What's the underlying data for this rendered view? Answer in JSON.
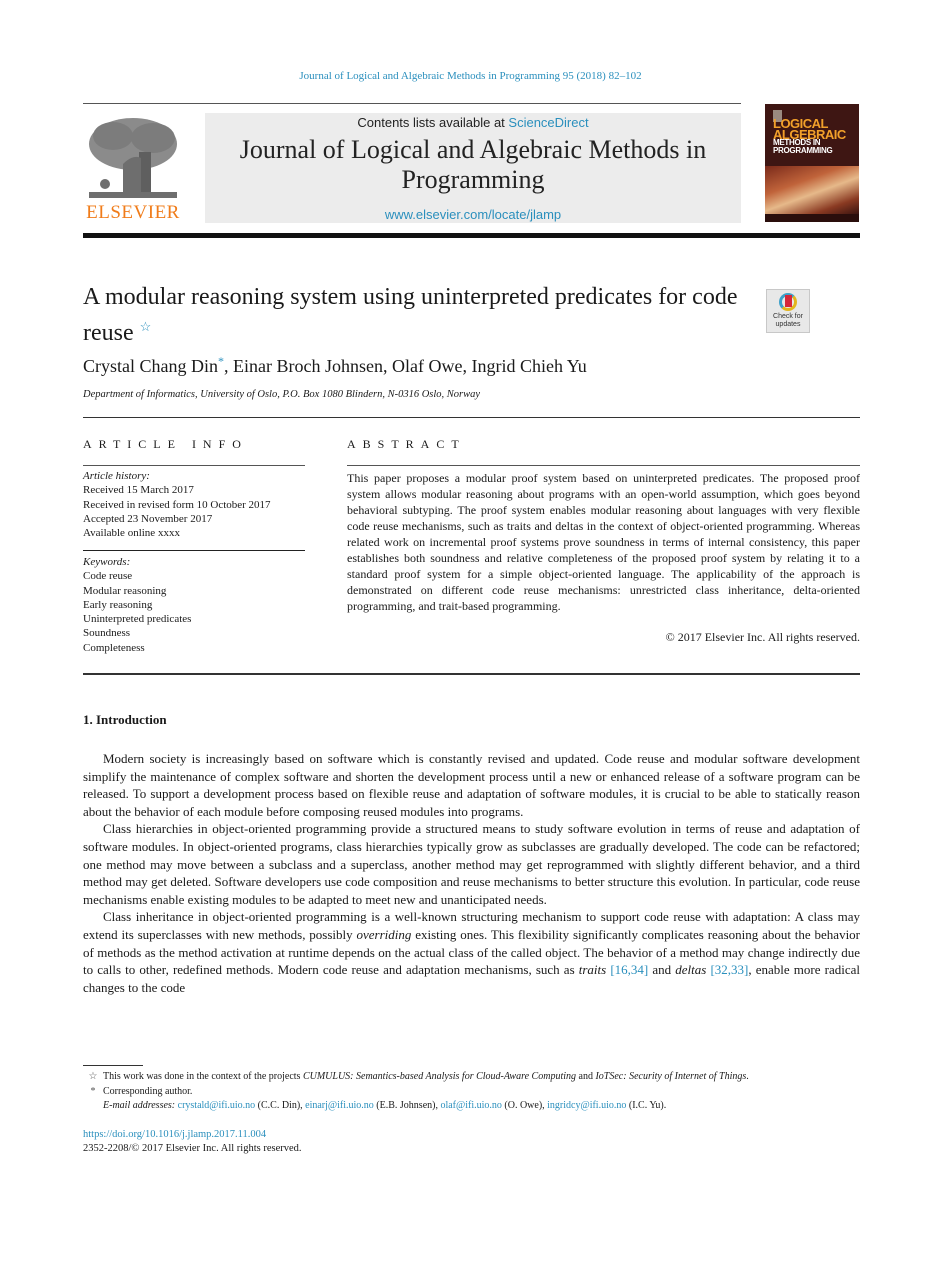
{
  "running_head": "Journal of Logical and Algebraic Methods in Programming 95 (2018) 82–102",
  "masthead": {
    "contents_prefix": "Contents lists available at ",
    "contents_link": "ScienceDirect",
    "journal_title": "Journal of Logical and Algebraic Methods in Programming",
    "journal_url": "www.elsevier.com/locate/jlamp",
    "publisher_wordmark": "ELSEVIER",
    "cover": {
      "title_line1": "LOGICAL",
      "title_line2": "ALGEBRAIC",
      "title_line3": "METHODS IN",
      "title_line4": "PROGRAMMING"
    },
    "colors": {
      "link": "#2a8fbd",
      "elsevier_orange": "#f07c1a"
    }
  },
  "article": {
    "title": "A modular reasoning system using uninterpreted predicates for code reuse",
    "title_footnote_mark": "☆",
    "check_updates_label": "Check for updates",
    "authors": [
      {
        "name": "Crystal Chang Din",
        "mark": "*"
      },
      {
        "name": "Einar Broch Johnsen",
        "mark": ""
      },
      {
        "name": "Olaf Owe",
        "mark": ""
      },
      {
        "name": "Ingrid Chieh Yu",
        "mark": ""
      }
    ],
    "author_separator": ", ",
    "affiliation": "Department of Informatics, University of Oslo, P.O. Box 1080 Blindern, N-0316 Oslo, Norway"
  },
  "article_info": {
    "heading": "ARTICLE INFO",
    "history_label": "Article history:",
    "history": [
      "Received 15 March 2017",
      "Received in revised form 10 October 2017",
      "Accepted 23 November 2017",
      "Available online xxxx"
    ],
    "keywords_label": "Keywords:",
    "keywords": [
      "Code reuse",
      "Modular reasoning",
      "Early reasoning",
      "Uninterpreted predicates",
      "Soundness",
      "Completeness"
    ]
  },
  "abstract": {
    "heading": "ABSTRACT",
    "text": "This paper proposes a modular proof system based on uninterpreted predicates. The proposed proof system allows modular reasoning about programs with an open-world assumption, which goes beyond behavioral subtyping. The proof system enables modular reasoning about languages with very flexible code reuse mechanisms, such as traits and deltas in the context of object-oriented programming. Whereas related work on incremental proof systems prove soundness in terms of internal consistency, this paper establishes both soundness and relative completeness of the proposed proof system by relating it to a standard proof system for a simple object-oriented language. The applicability of the approach is demonstrated on different code reuse mechanisms: unrestricted class inheritance, delta-oriented programming, and trait-based programming.",
    "copyright": "© 2017 Elsevier Inc. All rights reserved."
  },
  "introduction": {
    "heading": "1.  Introduction",
    "paragraphs": {
      "p1": "Modern society is increasingly based on software which is constantly revised and updated. Code reuse and modular software development simplify the maintenance of complex software and shorten the development process until a new or enhanced release of a software program can be released. To support a development process based on flexible reuse and adaptation of software modules, it is crucial to be able to statically reason about the behavior of each module before composing reused modules into programs.",
      "p2": "Class hierarchies in object-oriented programming provide a structured means to study software evolution in terms of reuse and adaptation of software modules. In object-oriented programs, class hierarchies typically grow as subclasses are gradually developed. The code can be refactored; one method may move between a subclass and a superclass, another method may get reprogrammed with slightly different behavior, and a third method may get deleted. Software developers use code composition and reuse mechanisms to better structure this evolution. In particular, code reuse mechanisms enable existing modules to be adapted to meet new and unanticipated needs.",
      "p3": {
        "a": "Class inheritance in object-oriented programming is a well-known structuring mechanism to support code reuse with adaptation: A class may extend its superclasses with new methods, possibly ",
        "em1": "overriding",
        "b": " existing ones. This flexibility significantly complicates reasoning about the behavior of methods as the method activation at runtime depends on the actual class of the called object. The behavior of a method may change indirectly due to calls to other, redefined methods. Modern code reuse and adaptation mechanisms, such as ",
        "em2": "traits",
        "ref1": "[16,34]",
        "c": " and ",
        "em3": "deltas",
        "ref2": "[32,33]",
        "d": ", enable more radical changes to the code"
      }
    }
  },
  "footnotes": {
    "star_mark": "☆",
    "star_text_a": "This work was done in the context of the projects ",
    "star_project1": "CUMULUS: Semantics-based Analysis for Cloud-Aware Computing",
    "star_text_b": " and ",
    "star_project2": "IoTSec: Security of Internet of Things",
    "star_text_c": ".",
    "corr_mark": "*",
    "corr_text": "Corresponding author.",
    "email_label": "E-mail addresses: ",
    "emails": [
      {
        "address": "crystald@ifi.uio.no",
        "who": " (C.C. Din), "
      },
      {
        "address": "einarj@ifi.uio.no",
        "who": " (E.B. Johnsen), "
      },
      {
        "address": "olaf@ifi.uio.no",
        "who": " (O. Owe), "
      },
      {
        "address": "ingridcy@ifi.uio.no",
        "who": " (I.C. Yu)."
      }
    ]
  },
  "doi": "https://doi.org/10.1016/j.jlamp.2017.11.004",
  "issn_line": "2352-2208/© 2017 Elsevier Inc. All rights reserved."
}
